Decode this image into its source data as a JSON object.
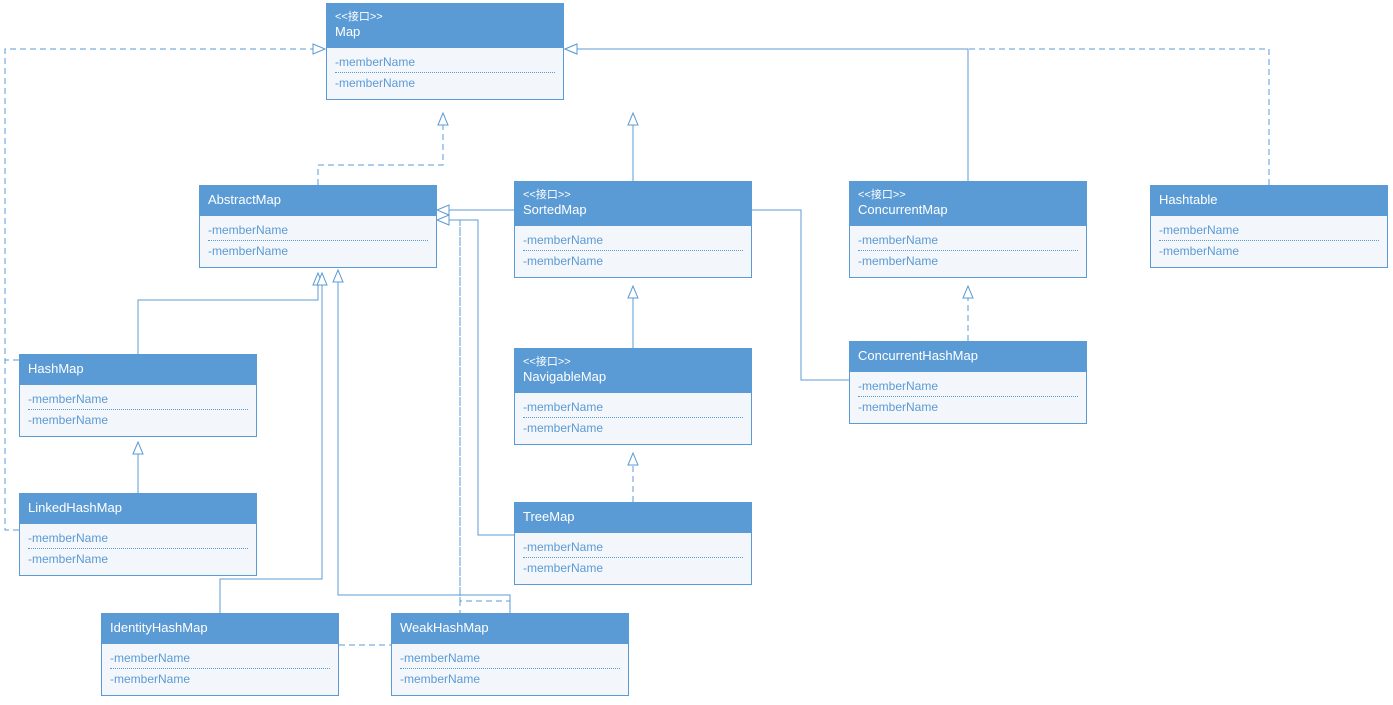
{
  "stereotype": "<<接口>>",
  "memberName": "-memberName",
  "classes": {
    "map": {
      "name": "Map",
      "interface": true
    },
    "abstractMap": {
      "name": "AbstractMap",
      "interface": false
    },
    "sortedMap": {
      "name": "SortedMap",
      "interface": true
    },
    "concurrentMap": {
      "name": "ConcurrentMap",
      "interface": true
    },
    "hashtable": {
      "name": "Hashtable",
      "interface": false
    },
    "hashMap": {
      "name": "HashMap",
      "interface": false
    },
    "navigableMap": {
      "name": "NavigableMap",
      "interface": true
    },
    "concurrentHashMap": {
      "name": "ConcurrentHashMap",
      "interface": false
    },
    "linkedHashMap": {
      "name": "LinkedHashMap",
      "interface": false
    },
    "treeMap": {
      "name": "TreeMap",
      "interface": false
    },
    "identityHashMap": {
      "name": "IdentityHashMap",
      "interface": false
    },
    "weakHashMap": {
      "name": "WeakHashMap",
      "interface": false
    }
  },
  "colors": {
    "fill": "#5b9bd5",
    "line": "#5b9bd5"
  }
}
